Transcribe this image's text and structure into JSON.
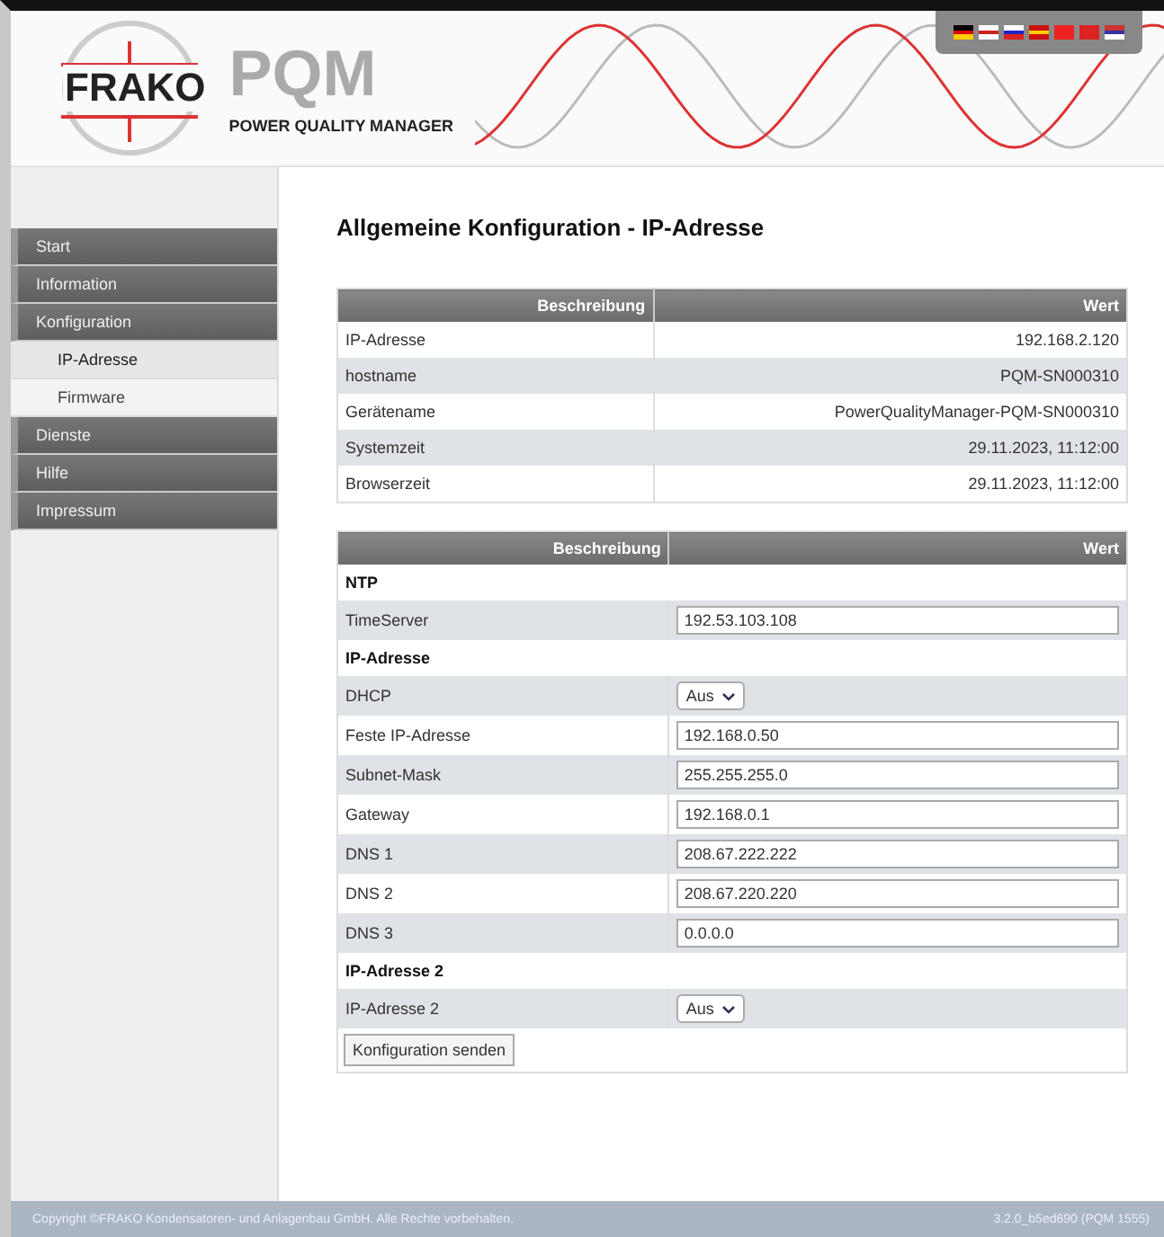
{
  "header": {
    "brand": "FRAKO",
    "product": "PQM",
    "subtitle": "POWER QUALITY MANAGER"
  },
  "sidebar": {
    "items": [
      {
        "label": "Start",
        "selected": false
      },
      {
        "label": "Information",
        "selected": false
      },
      {
        "label": "Konfiguration",
        "selected": false,
        "children": [
          {
            "label": "IP-Adresse",
            "selected": true
          },
          {
            "label": "Firmware",
            "selected": false
          }
        ]
      },
      {
        "label": "Dienste",
        "selected": false
      },
      {
        "label": "Hilfe",
        "selected": false
      },
      {
        "label": "Impressum",
        "selected": false
      }
    ]
  },
  "page_title": "Allgemeine Konfiguration - IP-Adresse",
  "info_table": {
    "columns": [
      "Beschreibung",
      "Wert"
    ],
    "rows": [
      [
        "IP-Adresse",
        "192.168.2.120"
      ],
      [
        "hostname",
        "PQM-SN000310"
      ],
      [
        "Gerätename",
        "PowerQualityManager-PQM-SN000310"
      ],
      [
        "Systemzeit",
        "29.11.2023, 11:12:00"
      ],
      [
        "Browserzeit",
        "29.11.2023, 11:12:00"
      ]
    ]
  },
  "config_table": {
    "columns": [
      "Beschreibung",
      "Wert"
    ],
    "rows": [
      {
        "kind": "section",
        "label": "NTP"
      },
      {
        "kind": "input",
        "label": "TimeServer",
        "value": "192.53.103.108"
      },
      {
        "kind": "section",
        "label": "IP-Adresse"
      },
      {
        "kind": "select",
        "label": "DHCP",
        "value": "Aus"
      },
      {
        "kind": "input",
        "label": "Feste IP-Adresse",
        "value": "192.168.0.50"
      },
      {
        "kind": "input",
        "label": "Subnet-Mask",
        "value": "255.255.255.0"
      },
      {
        "kind": "input",
        "label": "Gateway",
        "value": "192.168.0.1"
      },
      {
        "kind": "input",
        "label": "DNS 1",
        "value": "208.67.222.222"
      },
      {
        "kind": "input",
        "label": "DNS 2",
        "value": "208.67.220.220"
      },
      {
        "kind": "input",
        "label": "DNS 3",
        "value": "0.0.0.0"
      },
      {
        "kind": "section",
        "label": "IP-Adresse 2"
      },
      {
        "kind": "select",
        "label": "IP-Adresse 2",
        "value": "Aus"
      }
    ],
    "submit": "Konfiguration senden"
  },
  "footer": {
    "copyright": "Copyright ©FRAKO Kondensatoren- und Anlagenbau GmbH. Alle Rechte vorbehalten.",
    "version": "3.2.0_b5ed690 (PQM 1555)"
  }
}
